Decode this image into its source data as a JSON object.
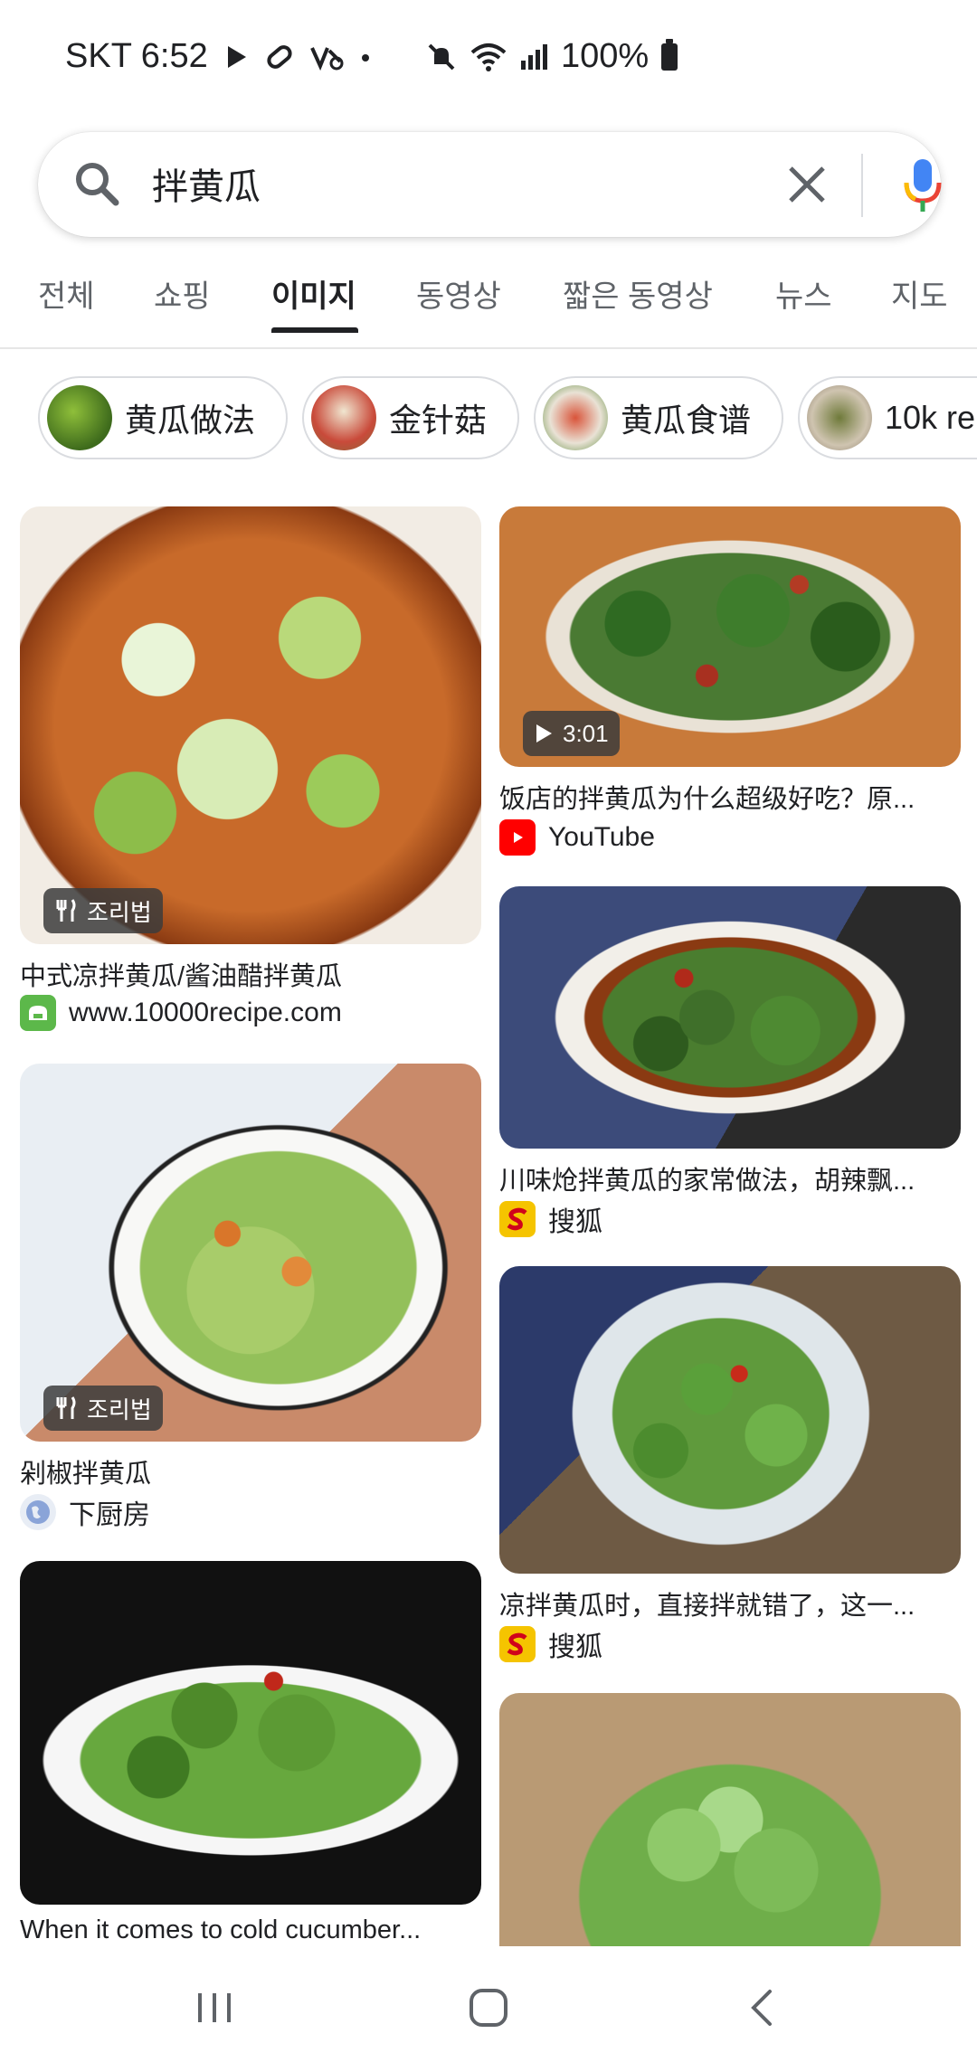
{
  "status_bar": {
    "carrier_time": "SKT 6:52",
    "battery": "100%",
    "icons": [
      "play-store-icon",
      "pill-icon",
      "missed-call-icon",
      "dot-icon",
      "mute-icon",
      "wifi-icon",
      "signal-icon",
      "battery-icon"
    ]
  },
  "search": {
    "query": "拌黄瓜"
  },
  "tabs": [
    {
      "label": "전체"
    },
    {
      "label": "쇼핑"
    },
    {
      "label": "이미지"
    },
    {
      "label": "동영상"
    },
    {
      "label": "짧은 동영상"
    },
    {
      "label": "뉴스"
    },
    {
      "label": "지도"
    }
  ],
  "chips": [
    {
      "label": "黄瓜做法"
    },
    {
      "label": "金针菇"
    },
    {
      "label": "黄瓜食谱"
    },
    {
      "label": "10k re"
    }
  ],
  "results": [
    {
      "title": "中式凉拌黄瓜/酱油醋拌黄瓜",
      "source": "www.10000recipe.com",
      "badge": "조리법"
    },
    {
      "title": "饭店的拌黄瓜为什么超级好吃？原...",
      "source": "YouTube",
      "badge": "3:01"
    },
    {
      "title": "剁椒拌黄瓜",
      "source": "下厨房",
      "badge": "조리법"
    },
    {
      "title": "川味炝拌黄瓜的家常做法，胡辣飘...",
      "source": "搜狐"
    },
    {
      "title": "凉拌黄瓜时，直接拌就错了，这一...",
      "source": "搜狐"
    },
    {
      "title": "When it comes to cold cucumber..."
    },
    {}
  ],
  "colors": {
    "accent": "#1a73e8",
    "youtube_red": "#ff0000",
    "sohu_yellow": "#f5c400"
  }
}
